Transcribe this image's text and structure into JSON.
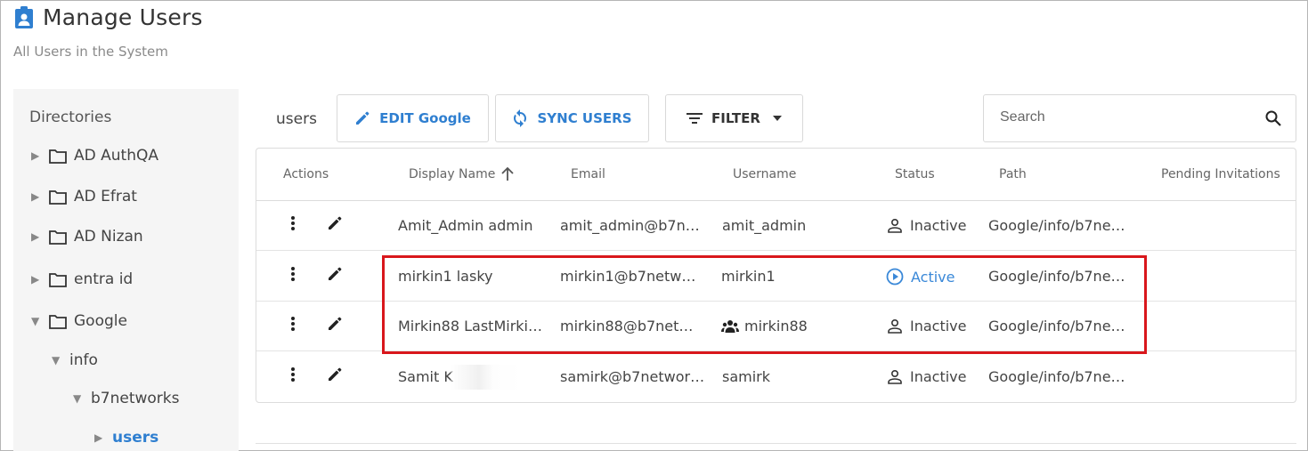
{
  "header": {
    "title": "Manage Users",
    "subtitle": "All Users in the System",
    "icon": "user-badge-icon"
  },
  "sidebar": {
    "title": "Directories",
    "items": [
      {
        "label": "AD AuthQA",
        "expanded": false
      },
      {
        "label": "AD Efrat",
        "expanded": false
      },
      {
        "label": "AD Nizan",
        "expanded": false
      },
      {
        "label": "entra id",
        "expanded": false
      },
      {
        "label": "Google",
        "expanded": true
      },
      {
        "label": "info",
        "expanded": true
      },
      {
        "label": "b7networks",
        "expanded": true
      },
      {
        "label": "users",
        "selected": true
      }
    ]
  },
  "toolbar": {
    "label": "users",
    "edit_label": "EDIT Google",
    "sync_label": "SYNC USERS",
    "filter_label": "FILTER",
    "search_placeholder": "Search"
  },
  "table": {
    "columns": [
      "Actions",
      "Display Name",
      "Email",
      "Username",
      "Status",
      "Path",
      "Pending Invitations"
    ],
    "sort_indicator": "arrow-up-icon",
    "rows": [
      {
        "display_name": "Amit_Admin admin",
        "email": "amit_admin@b7n…",
        "username": "amit_admin",
        "status": "Inactive",
        "path": "Google/info/b7ne…",
        "group": false
      },
      {
        "display_name": "mirkin1 lasky",
        "email": "mirkin1@b7netw…",
        "username": "mirkin1",
        "status": "Active",
        "path": "Google/info/b7ne…",
        "group": false
      },
      {
        "display_name": "Mirkin88 LastMirki…",
        "email": "mirkin88@b7net…",
        "username": "mirkin88",
        "status": "Inactive",
        "path": "Google/info/b7ne…",
        "group": true
      },
      {
        "display_name": "Samit K",
        "email": "samirk@b7networ…",
        "username": "samirk",
        "status": "Inactive",
        "path": "Google/info/b7ne…",
        "group": false
      }
    ]
  },
  "colors": {
    "accent": "#2f7fd0",
    "active_status": "#3a88d8",
    "highlight_border": "#d9171c"
  }
}
